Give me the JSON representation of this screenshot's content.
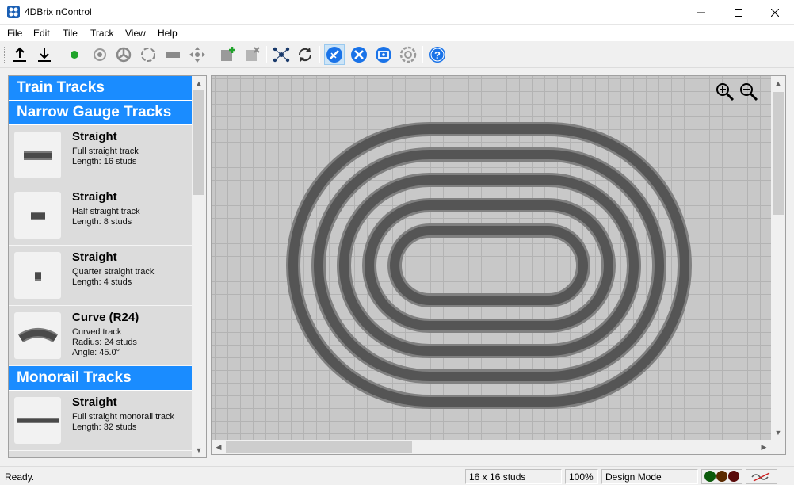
{
  "window": {
    "title": "4DBrix nControl",
    "app_icon": "4dbrix-logo-icon",
    "controls": [
      "minimize-icon",
      "maximize-icon",
      "close-icon"
    ]
  },
  "menu": [
    "File",
    "Edit",
    "Tile",
    "Track",
    "View",
    "Help"
  ],
  "toolbar": {
    "buttons": [
      "upload-icon",
      "download-icon",
      "green-dot-icon",
      "sensor-icon",
      "switch-icon",
      "loop-icon",
      "track-piece-icon",
      "move-icon",
      "add-tile-icon",
      "remove-tile-icon",
      "network-icon",
      "sync-icon",
      "design-mode-icon",
      "tools-icon",
      "monitor-icon",
      "settings-icon",
      "help-icon"
    ],
    "active_button": "design-mode-icon"
  },
  "palette": {
    "categories": [
      {
        "title": "Train Tracks"
      },
      {
        "title": "Narrow Gauge Tracks"
      },
      {
        "title": "Monorail Tracks"
      }
    ],
    "narrow_gauge_items": [
      {
        "name": "Straight",
        "desc": "Full straight track",
        "lines": [
          "Length: 16 studs"
        ]
      },
      {
        "name": "Straight",
        "desc": "Half straight track",
        "lines": [
          "Length: 8 studs"
        ]
      },
      {
        "name": "Straight",
        "desc": "Quarter straight track",
        "lines": [
          "Length: 4 studs"
        ]
      },
      {
        "name": "Curve (R24)",
        "desc": "Curved track",
        "lines": [
          "Radius: 24 studs",
          "Angle: 45.0°"
        ]
      }
    ],
    "monorail_items": [
      {
        "name": "Straight",
        "desc": "Full straight monorail track",
        "lines": [
          "Length: 32 studs"
        ]
      }
    ]
  },
  "canvas": {
    "zoom_in_icon": "zoom-in-icon",
    "zoom_out_icon": "zoom-out-icon",
    "track_color": "#555555",
    "track_edge_color": "#808080",
    "grid_color": "#b3b3b3",
    "background_color": "#c8c8c8",
    "loop_count": 5
  },
  "status": {
    "message": "Ready.",
    "tile_size": "16 x 16 studs",
    "zoom": "100%",
    "mode": "Design Mode",
    "indicator_colors": [
      "#0b5a0b",
      "#5a2a00",
      "#5a0a0a"
    ]
  },
  "colors": {
    "accent": "#1a8cff",
    "active_toolbar": "#cce4f7"
  }
}
